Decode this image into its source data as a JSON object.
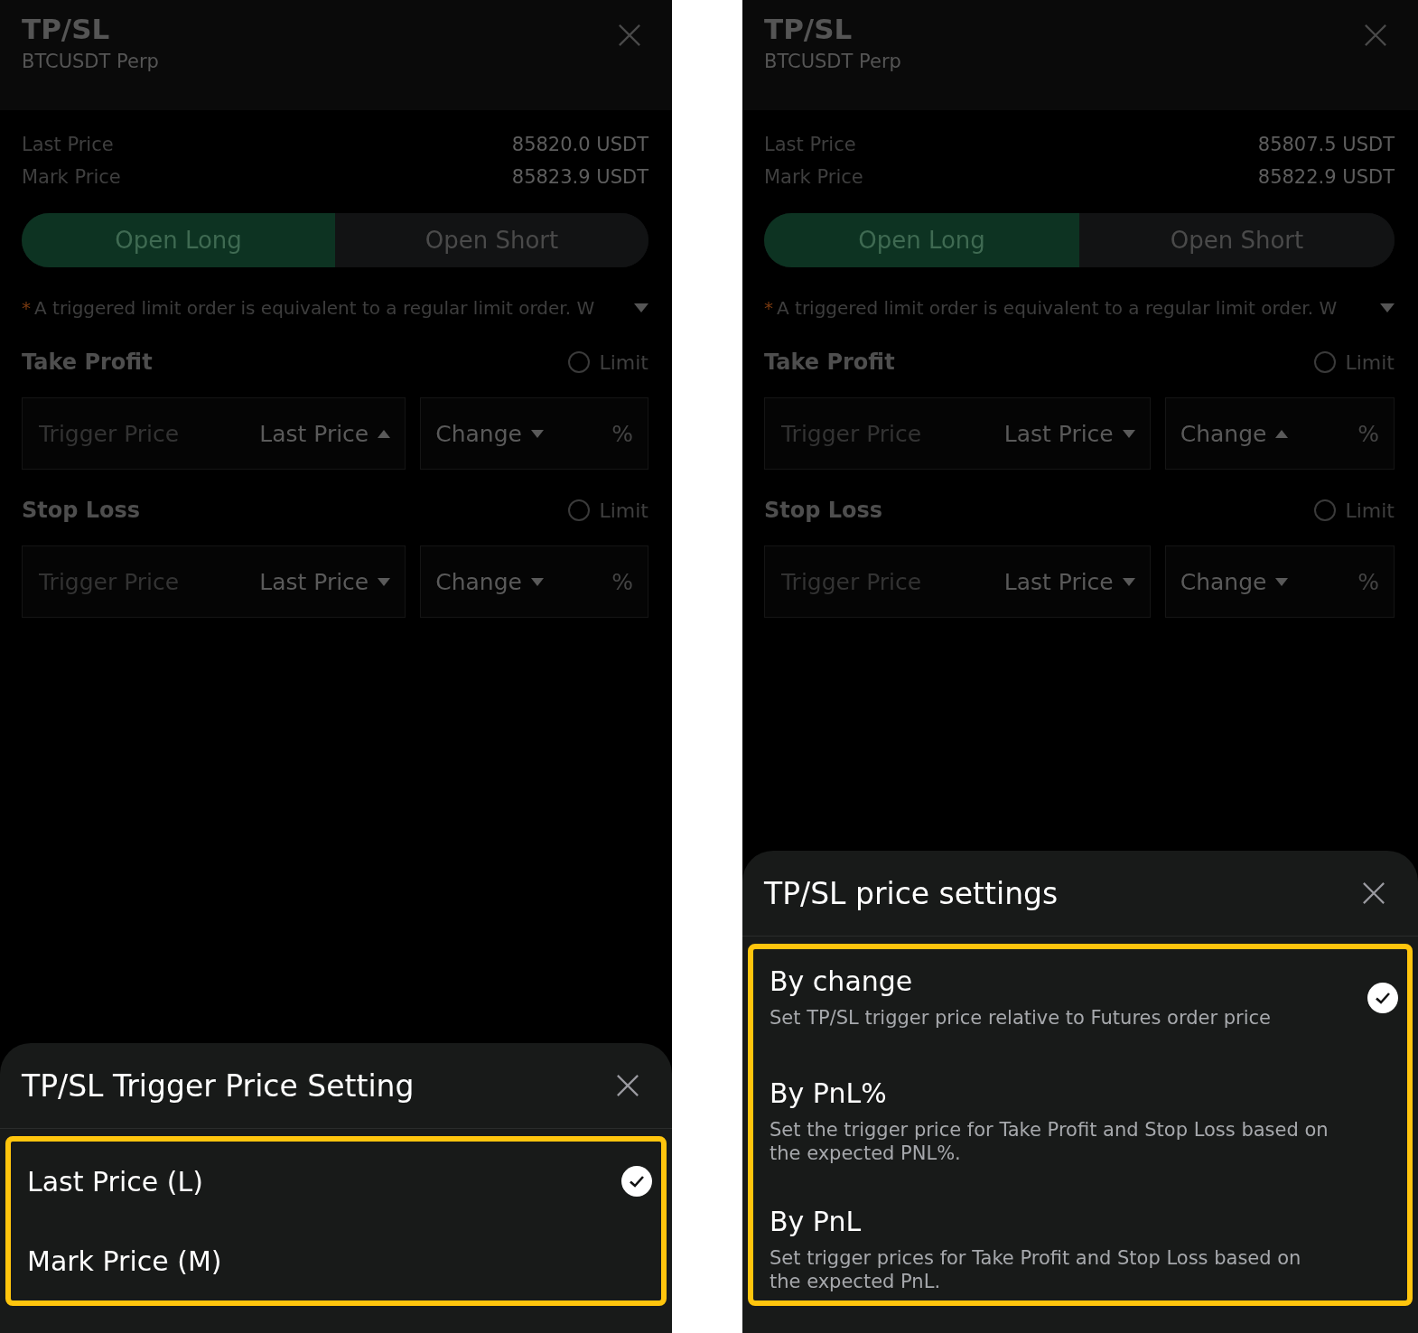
{
  "panels": [
    {
      "title": "TP/SL",
      "subtitle": "BTCUSDT Perp",
      "prices": [
        {
          "label": "Last Price",
          "value": "85820.0 USDT"
        },
        {
          "label": "Mark Price",
          "value": "85823.9 USDT"
        }
      ],
      "sides": [
        {
          "label": "Open Long",
          "selected": true
        },
        {
          "label": "Open Short",
          "selected": false
        }
      ],
      "notice": {
        "mark": "*",
        "text": "A triggered limit order is equivalent to a regular limit order. W"
      },
      "sections": [
        {
          "title": "Take Profit",
          "limit": {
            "label": "Limit",
            "checked": false
          },
          "placeholder": "Trigger Price",
          "price_type": {
            "label": "Last Price",
            "expanded": true
          },
          "change": {
            "label": "Change",
            "expanded": false
          },
          "unit": "%"
        },
        {
          "title": "Stop Loss",
          "limit": {
            "label": "Limit",
            "checked": false
          },
          "placeholder": "Trigger Price",
          "price_type": {
            "label": "Last Price",
            "expanded": false
          },
          "change": {
            "label": "Change",
            "expanded": false
          },
          "unit": "%"
        }
      ],
      "sheet": {
        "title": "TP/SL Trigger Price Setting",
        "highlighted": true,
        "options": [
          {
            "label": "Last Price (L)",
            "selected": true
          },
          {
            "label": "Mark Price (M)",
            "selected": false
          }
        ]
      }
    },
    {
      "title": "TP/SL",
      "subtitle": "BTCUSDT Perp",
      "prices": [
        {
          "label": "Last Price",
          "value": "85807.5 USDT"
        },
        {
          "label": "Mark Price",
          "value": "85822.9 USDT"
        }
      ],
      "sides": [
        {
          "label": "Open Long",
          "selected": true
        },
        {
          "label": "Open Short",
          "selected": false
        }
      ],
      "notice": {
        "mark": "*",
        "text": "A triggered limit order is equivalent to a regular limit order. W"
      },
      "sections": [
        {
          "title": "Take Profit",
          "limit": {
            "label": "Limit",
            "checked": false
          },
          "placeholder": "Trigger Price",
          "price_type": {
            "label": "Last Price",
            "expanded": false
          },
          "change": {
            "label": "Change",
            "expanded": true
          },
          "unit": "%"
        },
        {
          "title": "Stop Loss",
          "limit": {
            "label": "Limit",
            "checked": false
          },
          "placeholder": "Trigger Price",
          "price_type": {
            "label": "Last Price",
            "expanded": false
          },
          "change": {
            "label": "Change",
            "expanded": false
          },
          "unit": "%"
        }
      ],
      "sheet": {
        "title": "TP/SL price settings",
        "highlighted": true,
        "options": [
          {
            "label": "By change",
            "description": "Set TP/SL trigger price relative to Futures order price",
            "selected": true
          },
          {
            "label": "By PnL%",
            "description": "Set the trigger price for Take Profit and Stop Loss based on the expected PNL%.",
            "selected": false
          },
          {
            "label": "By PnL",
            "description": "Set trigger prices for Take Profit and Stop Loss based on the expected PnL.",
            "selected": false
          }
        ]
      }
    }
  ]
}
